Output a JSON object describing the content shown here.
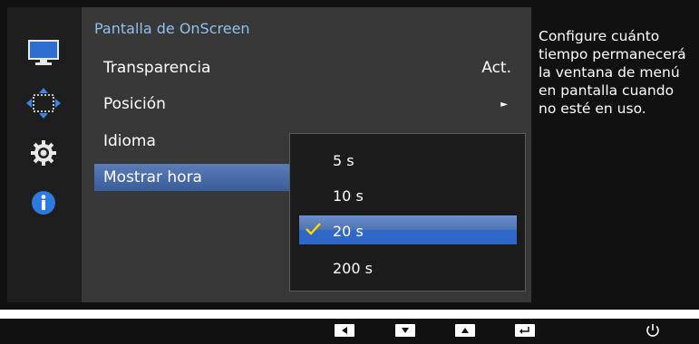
{
  "menu": {
    "title": "Pantalla de OnScreen",
    "items": [
      {
        "label": "Transparencia",
        "value": "Act.",
        "has_arrow": false
      },
      {
        "label": "Posición",
        "value": "",
        "has_arrow": true
      },
      {
        "label": "Idioma",
        "value": "",
        "has_arrow": false
      },
      {
        "label": "Mostrar hora",
        "value": "",
        "has_arrow": false,
        "selected": true
      }
    ]
  },
  "dropdown": {
    "options": [
      {
        "label": "5 s",
        "selected": false
      },
      {
        "label": "10 s",
        "selected": false
      },
      {
        "label": "20 s",
        "selected": true
      },
      {
        "label": "200 s",
        "selected": false
      }
    ]
  },
  "help": {
    "text": "Configure cuánto tiempo permanecerá la ventana de menú en pantalla cuando no esté en uso."
  },
  "sidebar": {
    "icons": [
      "monitor-icon",
      "position-arrows-icon",
      "gear-icon",
      "info-icon"
    ]
  },
  "controls": {
    "keys": [
      "left-key-icon",
      "down-key-icon",
      "up-key-icon",
      "enter-key-icon",
      "power-icon"
    ]
  },
  "colors": {
    "title": "#8fc0f0",
    "selection": "#3a5c99",
    "checkmark": "#ffd600",
    "panel_bg": "#383838"
  }
}
